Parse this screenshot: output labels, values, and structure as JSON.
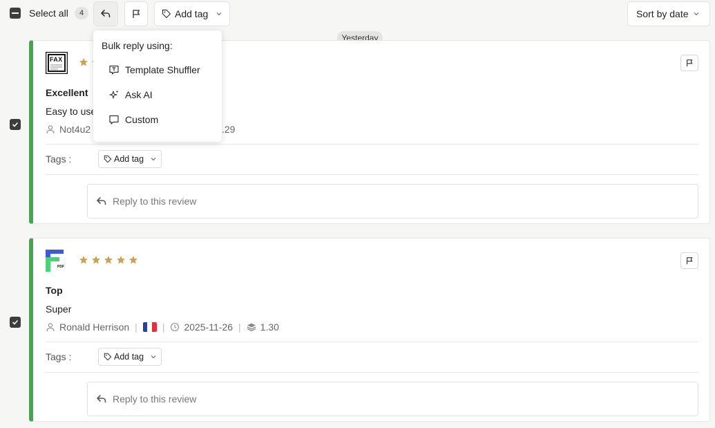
{
  "toolbar": {
    "select_all_label": "Select all",
    "selected_count": "4",
    "add_tag_label": "Add tag",
    "sort_label": "Sort by date"
  },
  "day_separator": "Yesterday",
  "bulk_reply_menu": {
    "header": "Bulk reply using:",
    "items": [
      {
        "label": "Template Shuffler",
        "icon": "template-icon"
      },
      {
        "label": "Ask AI",
        "icon": "sparkle-icon"
      },
      {
        "label": "Custom",
        "icon": "chat-bubble-icon"
      }
    ]
  },
  "reviews": [
    {
      "app_logo_text": "FAX",
      "title": "Excellent",
      "body": "Easy to use",
      "author": "Not4u2",
      "version": "3.29",
      "tags_label": "Tags :",
      "add_tag_label": "Add tag",
      "reply_placeholder": "Reply to this review",
      "checked": true
    },
    {
      "app_logo_text": "PDF",
      "rating": 5,
      "title": "Top",
      "body": "Super",
      "author": "Ronald Herrison",
      "date": "2025-11-26",
      "version": "1.30",
      "tags_label": "Tags :",
      "add_tag_label": "Add tag",
      "reply_placeholder": "Reply to this review",
      "checked": true
    }
  ],
  "colors": {
    "accent_green": "#4aa355",
    "star_gold": "#c9a25b",
    "checkbox_dark": "#3d3d3d"
  }
}
